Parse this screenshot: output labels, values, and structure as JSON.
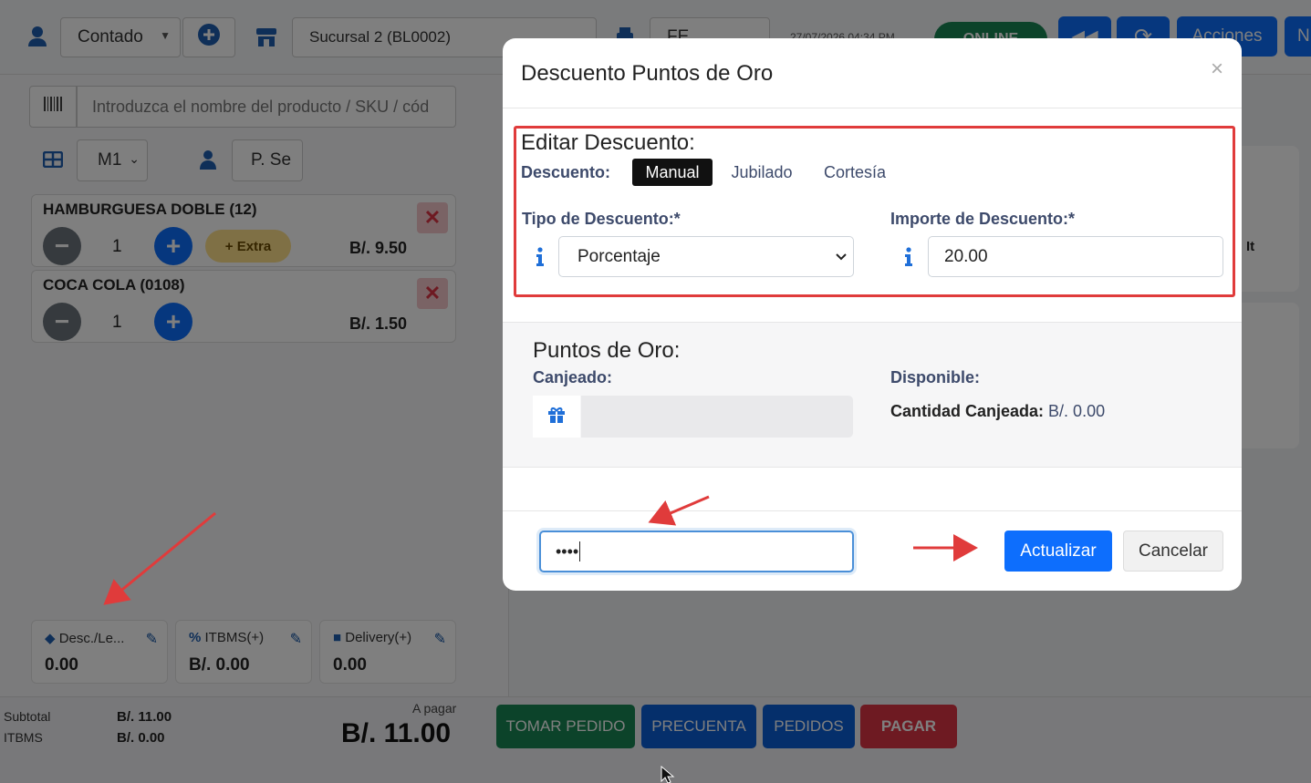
{
  "topbar": {
    "customer": "Contado",
    "branch": "Sucursal 2 (BL0002)",
    "doc_type": "FE",
    "datetime": "27/07/2026 04:34 PM",
    "online_label": "ONLINE",
    "actions_label": "Acciones",
    "extra_btn_label": "N"
  },
  "search": {
    "placeholder": "Introduzca el nombre del producto / SKU / cód"
  },
  "filters": {
    "table": "M1",
    "waiter": "P. Se"
  },
  "items": [
    {
      "name": "HAMBURGUESA DOBLE (12)",
      "qty": "1",
      "price": "B/. 9.50",
      "extra_label": "+ Extra"
    },
    {
      "name": "COCA COLA (0108)",
      "qty": "1",
      "price": "B/. 1.50"
    }
  ],
  "summary_cards": [
    {
      "label": "Desc./Le...",
      "value": "0.00"
    },
    {
      "label": "ITBMS(+)",
      "value": "B/. 0.00"
    },
    {
      "label": "Delivery(+)",
      "value": "0.00"
    }
  ],
  "totals": {
    "subtotal_label": "Subtotal",
    "subtotal_value": "B/. 11.00",
    "itbms_label": "ITBMS",
    "itbms_value": "B/. 0.00",
    "to_pay_label": "A pagar",
    "to_pay_value": "B/. 11.00"
  },
  "action_buttons": {
    "take_order": "TOMAR PEDIDO",
    "pre_bill": "PRECUENTA",
    "orders": "PEDIDOS",
    "pay": "PAGAR"
  },
  "right_partial_text": "It",
  "modal": {
    "title": "Descuento Puntos de Oro",
    "close": "×",
    "edit_section_title": "Editar Descuento:",
    "discount_label": "Descuento:",
    "discount_tabs": [
      "Manual",
      "Jubilado",
      "Cortesía"
    ],
    "type_label": "Tipo de Descuento:*",
    "type_value": "Porcentaje",
    "amount_label": "Importe de Descuento:*",
    "amount_value": "20.00",
    "points_title": "Puntos de Oro:",
    "redeemed_label": "Canjeado:",
    "available_label": "Disponible:",
    "redeemed_amount_label": "Cantidad Canjeada:",
    "redeemed_amount_value": "B/. 0.00",
    "password_value": "••••",
    "update_button": "Actualizar",
    "cancel_button": "Cancelar"
  },
  "colors": {
    "primary": "#0d6efd",
    "annotation": "#e03b3b",
    "success": "#198754",
    "danger": "#dc3545"
  }
}
